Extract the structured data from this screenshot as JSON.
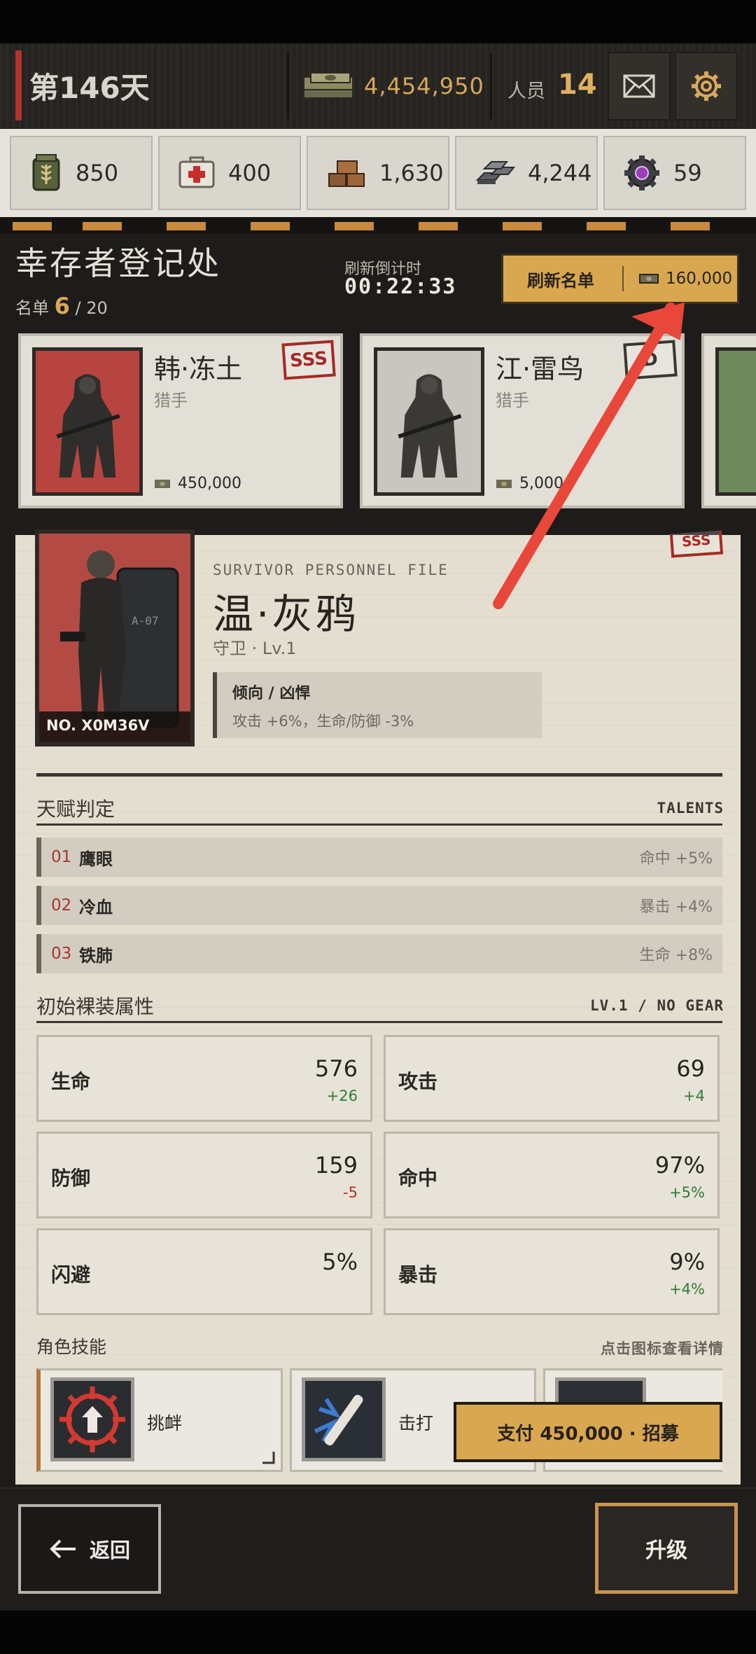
{
  "header": {
    "day": "第146天",
    "money": "4,454,950",
    "staff_label": "人员",
    "staff_count": "14"
  },
  "resources": [
    {
      "icon": "grain-sack-icon",
      "value": "850"
    },
    {
      "icon": "medkit-icon",
      "value": "400"
    },
    {
      "icon": "wood-logs-icon",
      "value": "1,630"
    },
    {
      "icon": "metal-ingots-icon",
      "value": "4,244"
    },
    {
      "icon": "gear-chip-icon",
      "value": "59"
    }
  ],
  "registry": {
    "title": "幸存者登记处",
    "roster_label": "名单",
    "roster_count": "6",
    "roster_max": "/ 20",
    "timer_label": "刷新倒计时",
    "timer": "00:22:33",
    "refresh_label": "刷新名单",
    "refresh_cost": "160,000"
  },
  "candidates": [
    {
      "name": "韩·冻土",
      "class": "猎手",
      "price": "450,000",
      "rank": "SSS"
    },
    {
      "name": "江·雷鸟",
      "class": "猎手",
      "price": "5,000",
      "rank": "D"
    }
  ],
  "file": {
    "subtitle": "SURVIVOR PERSONNEL FILE",
    "name": "温·灰鸦",
    "class": "守卫 · Lv.1",
    "portrait_no": "NO. X0M36V",
    "rank": "SSS",
    "tendency_title": "倾向 /  凶悍",
    "tendency_desc": "攻击 +6%，生命/防御 -3%",
    "talents_title": "天赋判定",
    "talents_right": "TALENTS",
    "talents": [
      {
        "num": "01",
        "name": "鹰眼",
        "effect": "命中 +5%"
      },
      {
        "num": "02",
        "name": "冷血",
        "effect": "暴击 +4%"
      },
      {
        "num": "03",
        "name": "铁肺",
        "effect": "生命 +8%"
      }
    ],
    "stats_title": "初始裸装属性",
    "stats_right": "LV.1 / NO GEAR",
    "stats": [
      {
        "label": "生命",
        "value": "576",
        "delta": "+26"
      },
      {
        "label": "攻击",
        "value": "69",
        "delta": "+4"
      },
      {
        "label": "防御",
        "value": "159",
        "delta": "-5"
      },
      {
        "label": "命中",
        "value": "97%",
        "delta": "+5%"
      },
      {
        "label": "闪避",
        "value": "5%",
        "delta": ""
      },
      {
        "label": "暴击",
        "value": "9%",
        "delta": "+4%"
      }
    ],
    "skills_title": "角色技能",
    "skills_right": "点击图标查看详情",
    "skills": [
      {
        "name": "挑衅"
      },
      {
        "name": "击打"
      }
    ],
    "recruit": "支付 450,000 · 招募"
  },
  "bottom": {
    "back": "返回",
    "upgrade": "升级"
  },
  "colors": {
    "accent_gold": "#d9a74f",
    "accent_red": "#b3322a",
    "annotation_arrow": "#e8473a"
  }
}
